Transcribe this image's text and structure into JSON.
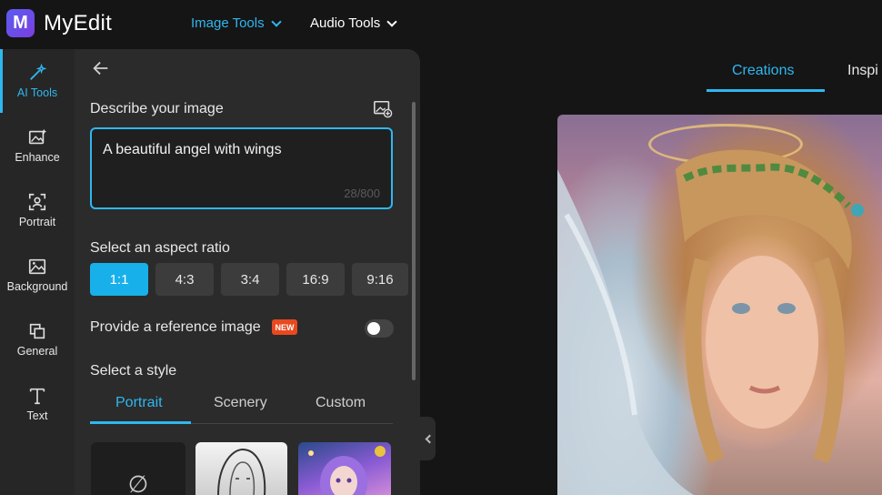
{
  "header": {
    "logo_letter": "M",
    "brand": "MyEdit",
    "nav": [
      {
        "label": "Image Tools",
        "active": true
      },
      {
        "label": "Audio Tools",
        "active": false
      }
    ]
  },
  "sidebar": {
    "items": [
      {
        "label": "AI Tools",
        "icon": "magic-wand-icon",
        "active": true
      },
      {
        "label": "Enhance",
        "icon": "image-sparkle-icon"
      },
      {
        "label": "Portrait",
        "icon": "portrait-icon"
      },
      {
        "label": "Background",
        "icon": "background-icon"
      },
      {
        "label": "General",
        "icon": "copy-icon"
      },
      {
        "label": "Text",
        "icon": "text-icon"
      }
    ]
  },
  "panel": {
    "describe_label": "Describe your image",
    "prompt_value": "A beautiful angel with wings",
    "prompt_counter": "28/800",
    "aspect_label": "Select an aspect ratio",
    "ratios": [
      "1:1",
      "4:3",
      "3:4",
      "16:9",
      "9:16"
    ],
    "selected_ratio": "1:1",
    "reference_label": "Provide a reference image",
    "new_badge": "NEW",
    "reference_enabled": false,
    "style_label": "Select a style",
    "style_tabs": [
      "Portrait",
      "Scenery",
      "Custom"
    ],
    "active_style_tab": "Portrait",
    "none_symbol": "∅"
  },
  "results": {
    "tabs": [
      "Creations",
      "Inspi"
    ],
    "active_tab": "Creations"
  },
  "colors": {
    "accent": "#2fb7f0",
    "badge": "#e9491f"
  }
}
